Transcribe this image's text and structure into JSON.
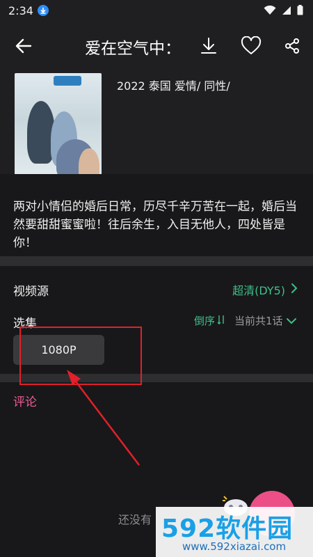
{
  "status_bar": {
    "time": "2:34"
  },
  "header": {
    "title": "爱在空气中："
  },
  "movie": {
    "meta": "2022 泰国 爱情/ 同性/",
    "description": "两对小情侣的婚后日常，历尽千辛万苦在一起，婚后当然要甜甜蜜蜜啦！往后余生，入目无他人，四处皆是你！"
  },
  "source": {
    "label": "视频源",
    "value": "超清(DY5)"
  },
  "episodes": {
    "label": "选集",
    "sort_label": "倒序",
    "count_label": "当前共1话",
    "items": [
      "1080P"
    ]
  },
  "comments": {
    "label": "评论",
    "empty_text": "还没有"
  },
  "watermark": {
    "main": "592软件园",
    "sub": "www.592xiazai.com"
  },
  "colors": {
    "accent_green": "#3fc08a",
    "accent_pink": "#ef5a94",
    "annotation_red": "#e2202a"
  },
  "icons": [
    "download-status-icon",
    "wifi-icon",
    "signal-icon",
    "battery-icon",
    "back-arrow-icon",
    "download-icon",
    "heart-icon",
    "share-icon",
    "chevron-right-icon",
    "sort-icon",
    "chevron-down-icon",
    "gamepad-icon"
  ]
}
